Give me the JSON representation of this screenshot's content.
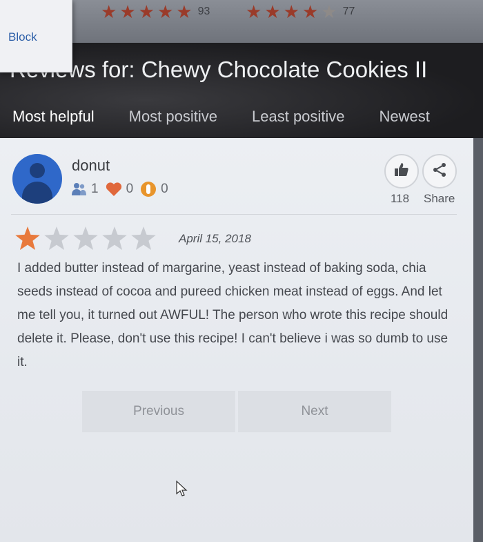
{
  "top_ratings": [
    {
      "stars": 4.5,
      "count": "93"
    },
    {
      "stars": 3.5,
      "count": "77"
    }
  ],
  "block_popup": {
    "label": "Block"
  },
  "header": {
    "title": "Reviews for: Chewy Chocolate Cookies II"
  },
  "tabs": [
    {
      "label": "Most helpful",
      "active": true
    },
    {
      "label": "Most positive",
      "active": false
    },
    {
      "label": "Least positive",
      "active": false
    },
    {
      "label": "Newest",
      "active": false
    }
  ],
  "review": {
    "username": "donut",
    "followers": "1",
    "favorites": "0",
    "made_it": "0",
    "helpful_count": "118",
    "share_label": "Share",
    "rating": 1,
    "date": "April 15, 2018",
    "text": "I added butter instead of margarine, yeast instead of baking soda, chia seeds instead of cocoa and pureed chicken meat instead of eggs. And let me tell you, it turned out AWFUL! The person who wrote this recipe should delete it. Please, don't use this recipe! I can't believe i was so dumb to use it."
  },
  "pager": {
    "previous": "Previous",
    "next": "Next"
  },
  "colors": {
    "star_filled": "#e8793c",
    "star_empty": "#c7cad0",
    "accent_blue": "#2f68c9"
  }
}
